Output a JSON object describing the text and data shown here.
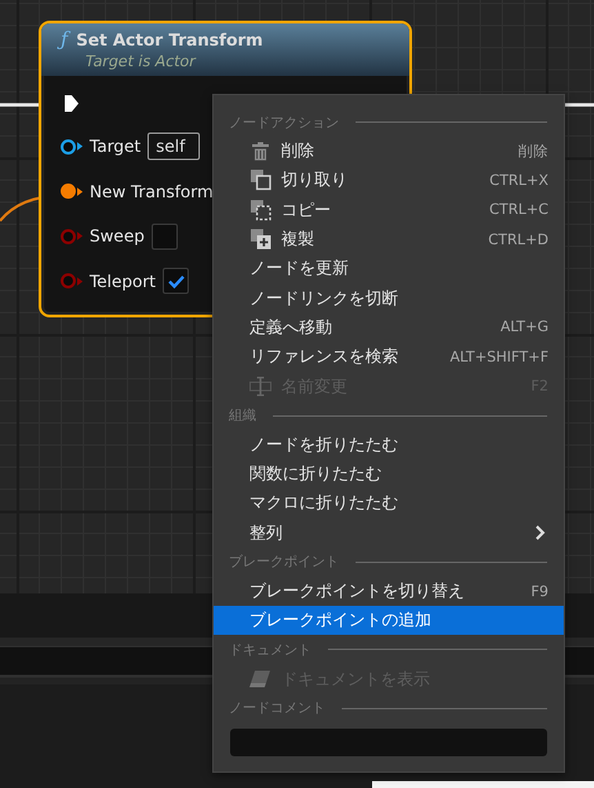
{
  "node": {
    "icon": "ƒ",
    "title": "Set Actor Transform",
    "subtitle": "Target is Actor",
    "pins": [
      {
        "kind": "exec"
      },
      {
        "kind": "object",
        "label": "Target",
        "value": "self",
        "color": "#1c9ee6",
        "connected": false
      },
      {
        "kind": "struct",
        "label": "New Transform",
        "color": "#f57c00",
        "connected": true
      },
      {
        "kind": "bool",
        "label": "Sweep",
        "color": "#8c0000",
        "connected": false,
        "checked": false
      },
      {
        "kind": "bool",
        "label": "Teleport",
        "color": "#8c0000",
        "connected": false,
        "checked": true
      }
    ]
  },
  "context_menu": {
    "sections": [
      {
        "heading": "ノードアクション",
        "items": [
          {
            "kind": "trash",
            "label": "削除",
            "shortcut": "削除",
            "disabled": false,
            "selected": false
          },
          {
            "kind": "cut",
            "label": "切り取り",
            "shortcut": "CTRL+X",
            "disabled": false,
            "selected": false
          },
          {
            "kind": "copy",
            "label": "コピー",
            "shortcut": "CTRL+C",
            "disabled": false,
            "selected": false
          },
          {
            "kind": "duplicate",
            "label": "複製",
            "shortcut": "CTRL+D",
            "disabled": false,
            "selected": false
          },
          {
            "kind": "plain",
            "label": "ノードを更新",
            "disabled": false,
            "selected": false
          },
          {
            "kind": "plain",
            "label": "ノードリンクを切断",
            "disabled": false,
            "selected": false
          },
          {
            "kind": "plain",
            "label": "定義へ移動",
            "shortcut": "ALT+G",
            "disabled": false,
            "selected": false
          },
          {
            "kind": "plain",
            "label": "リファレンスを検索",
            "shortcut": "ALT+SHIFT+F",
            "disabled": false,
            "selected": false
          },
          {
            "kind": "rename",
            "label": "名前変更",
            "shortcut": "F2",
            "disabled": true,
            "selected": false
          }
        ]
      },
      {
        "heading": "組織",
        "items": [
          {
            "kind": "plain",
            "label": "ノードを折りたたむ",
            "disabled": false,
            "selected": false
          },
          {
            "kind": "plain",
            "label": "関数に折りたたむ",
            "disabled": false,
            "selected": false
          },
          {
            "kind": "plain",
            "label": "マクロに折りたたむ",
            "disabled": false,
            "selected": false
          },
          {
            "kind": "submenu",
            "label": "整列",
            "disabled": false,
            "selected": false
          }
        ]
      },
      {
        "heading": "ブレークポイント",
        "items": [
          {
            "kind": "plain",
            "label": "ブレークポイントを切り替え",
            "shortcut": "F9",
            "disabled": false,
            "selected": false
          },
          {
            "kind": "plain",
            "label": "ブレークポイントの追加",
            "disabled": false,
            "selected": true
          }
        ]
      },
      {
        "heading": "ドキュメント",
        "items": [
          {
            "kind": "document",
            "label": "ドキュメントを表示",
            "disabled": true,
            "selected": false
          }
        ]
      },
      {
        "heading": "ノードコメント",
        "comment_field": true
      }
    ]
  }
}
